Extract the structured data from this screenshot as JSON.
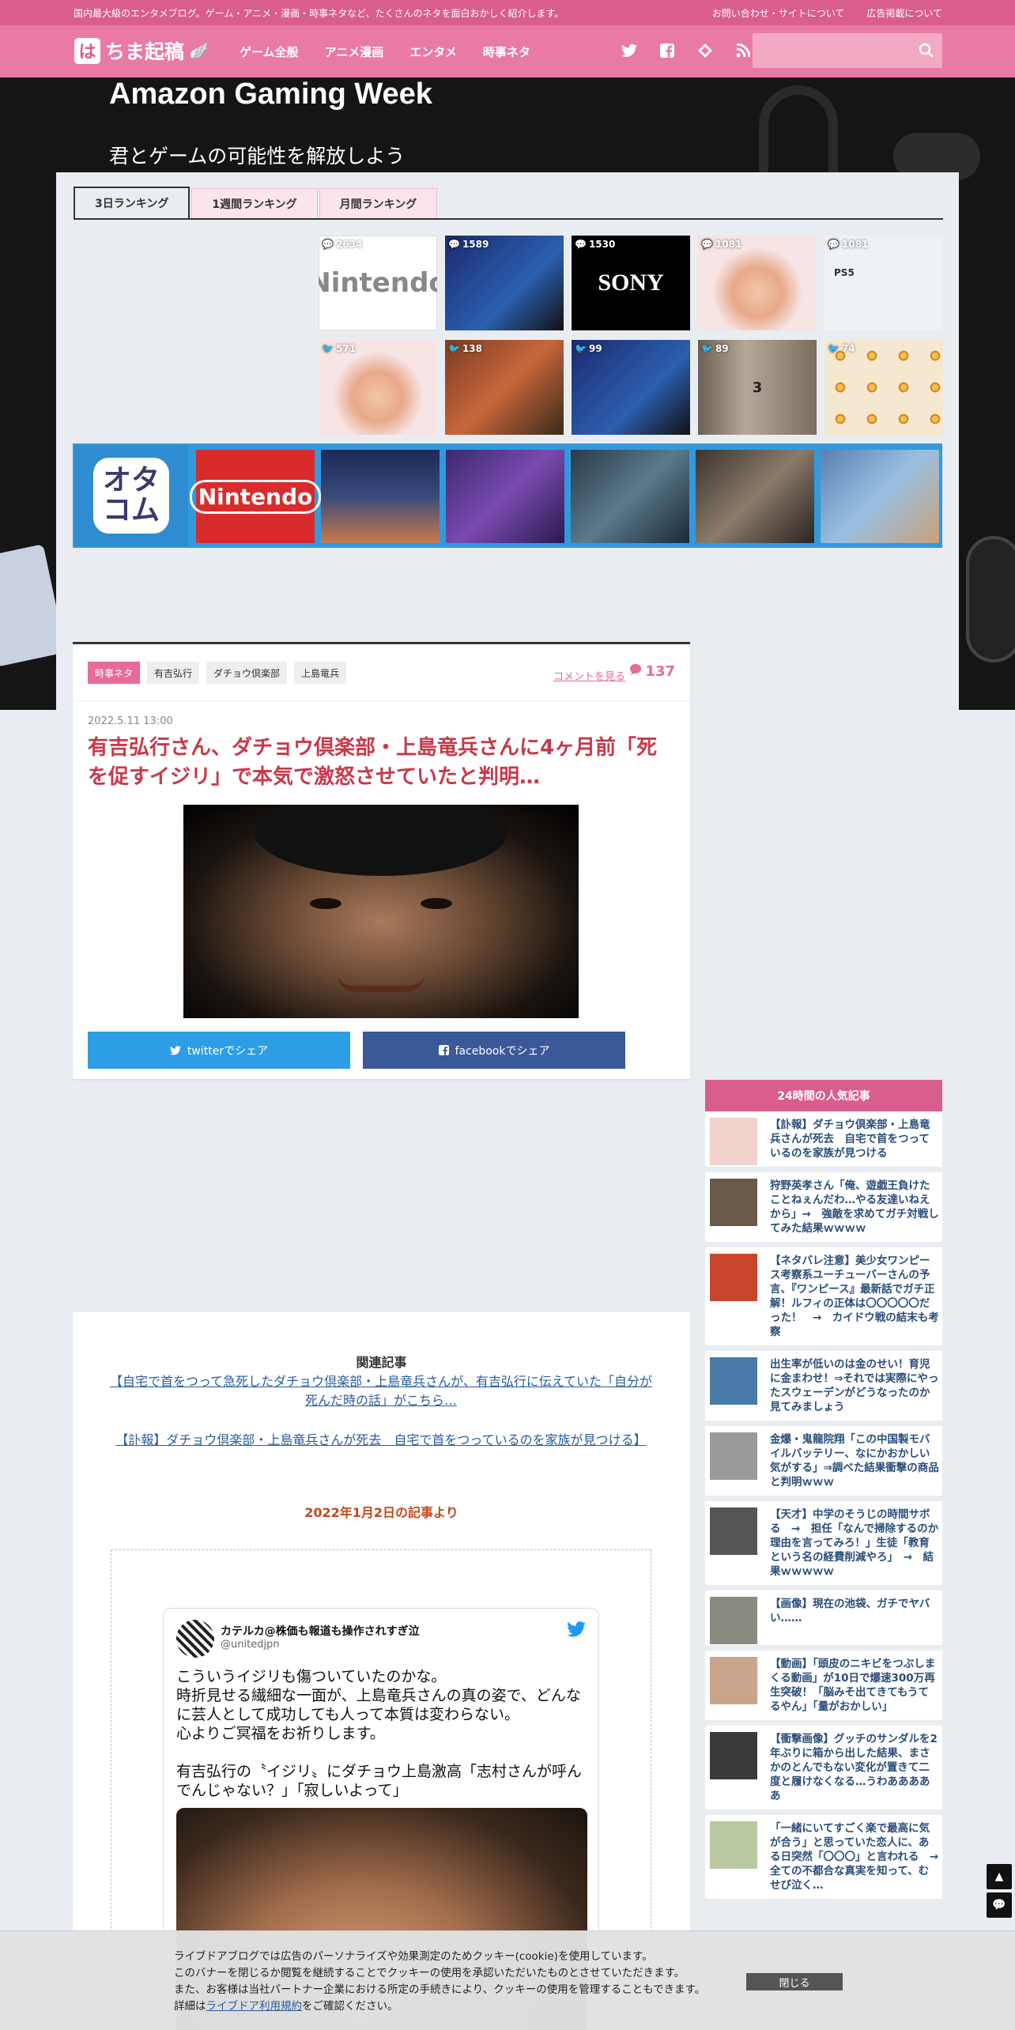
{
  "topbar": {
    "tagline": "国内最大級のエンタメブログ。ゲーム・アニメ・漫画・時事ネタなど、たくさんのネタを面白おかしく紹介します。",
    "contact": "お問い合わせ・サイトについて",
    "ads": "広告掲載について"
  },
  "header": {
    "logo_mark": "は",
    "logo_text": "ちま起稿",
    "nav": [
      "ゲーム全般",
      "アニメ漫画",
      "エンタメ",
      "時事ネタ"
    ],
    "social_icons": [
      "twitter-icon",
      "facebook-icon",
      "feedly-icon",
      "rss-icon"
    ],
    "search_placeholder": ""
  },
  "banner": {
    "title": "Amazon Gaming Week",
    "subtitle": "君とゲームの可能性を解放しよう"
  },
  "ranking": {
    "tabs": [
      "3日ランキング",
      "1週間ランキング",
      "月間ランキング"
    ],
    "items": [
      {
        "count": "2634",
        "type": "comment",
        "label": "Nintendo",
        "bg": "#ffffff",
        "fg": "#999999"
      },
      {
        "count": "1589",
        "type": "comment",
        "label": "",
        "bg": "#1c2a6e",
        "fg": "#ffffff"
      },
      {
        "count": "1530",
        "type": "comment",
        "label": "SONY",
        "bg": "#000000",
        "fg": "#ffffff"
      },
      {
        "count": "1081",
        "type": "comment",
        "label": "",
        "bg": "#f6dede",
        "fg": "#333333"
      },
      {
        "count": "1081",
        "type": "comment",
        "label": "PS5",
        "bg": "#e8ecf2",
        "fg": "#333333"
      },
      {
        "count": "571",
        "type": "twitter",
        "label": "",
        "bg": "#f6dede",
        "fg": "#333333"
      },
      {
        "count": "138",
        "type": "twitter",
        "label": "",
        "bg": "#7a3b22",
        "fg": "#ffffff"
      },
      {
        "count": "99",
        "type": "twitter",
        "label": "",
        "bg": "#1c2a6e",
        "fg": "#ffffff"
      },
      {
        "count": "89",
        "type": "twitter",
        "label": "3",
        "bg": "#9b8f80",
        "fg": "#333333"
      },
      {
        "count": "74",
        "type": "twitter",
        "label": "",
        "bg": "#c98a3a",
        "fg": "#ffffff"
      }
    ]
  },
  "promo": {
    "logo_text": "オタコム",
    "first_tile": "Nintendo",
    "tile_colors": [
      "#d92b2b",
      "#1b2a55",
      "#3a2a6e",
      "#2a3a4a",
      "#3b3530",
      "#5a7fb0"
    ]
  },
  "article": {
    "tags": [
      "時事ネタ",
      "有吉弘行",
      "ダチョウ倶楽部",
      "上島竜兵"
    ],
    "comment_link": "コメントを見る",
    "comment_count": "137",
    "date": "2022.5.11 13:00",
    "headline": "有吉弘行さん、ダチョウ倶楽部・上島竜兵さんに4ヶ月前「死を促すイジリ」で本気で激怒させていたと判明…",
    "share_twitter": "twitterでシェア",
    "share_facebook": "facebookでシェア"
  },
  "body": {
    "related_heading": "関連記事",
    "related1": "【自宅で首をつって急死したダチョウ倶楽部・上島竜兵さんが、有吉弘行に伝えていた「自分が死んだ時の話」がこちら…",
    "related2": "【訃報】ダチョウ倶楽部・上島竜兵さんが死去　自宅で首をつっているのを家族が見つける】",
    "date_note": "2022年1月2日の記事より",
    "tweet_name": "カテルカ@株価も報道も操作されすぎ泣",
    "tweet_handle": "@unitedjpn",
    "tweet_text": "こういうイジリも傷ついていたのかな。\n時折見せる繊細な一面が、上島竜兵さんの真の姿で、どんなに芸人として成功しても人って本質は変わらない。\n心よりご冥福をお祈りします。\n\n有吉弘行の〝イジリ〟にダチョウ上島激高「志村さんが呼んでんじゃない？」「寂しいよって」"
  },
  "popular": {
    "heading": "24時間の人気記事",
    "items": [
      {
        "text": "【訃報】ダチョウ倶楽部・上島竜兵さんが死去　自宅で首をつっているのを家族が見つける",
        "img": "#f1d2cc"
      },
      {
        "text": "狩野英孝さん「俺、遊戯王負けたことねぇんだわ…やる友達いねえから」→　強敵を求めてガチ対戦してみた結果ｗｗｗｗ",
        "img": "#6a5a4a"
      },
      {
        "text": "【ネタバレ注意】美少女ワンピース考察系ユーチューバーさんの予言、『ワンピース』最新話でガチ正解！ルフィの正体は〇〇〇〇〇だった！　→　カイドウ戦の結末も考察",
        "img": "#c8452e"
      },
      {
        "text": "出生率が低いのは金のせい！育児に金まわせ！⇒それでは実際にやったスウェーデンがどうなったのか見てみましょう",
        "img": "#4a7aa8"
      },
      {
        "text": "金爆・鬼龍院翔「この中国製モバイルバッテリー、なにかおかしい気がする」⇒調べた結果衝撃の商品と判明ｗｗｗ",
        "img": "#9a9a9a"
      },
      {
        "text": "【天才】中学のそうじの時間サボる　→　担任「なんで掃除するのか理由を言ってみろ！」生徒「教育という名の経費削減やろ」　→　結果ｗｗｗｗｗ",
        "img": "#555555"
      },
      {
        "text": "【画像】現在の池袋、ガチでヤバい……",
        "img": "#8a8a80"
      },
      {
        "text": "【動画】「頭皮のニキビをつぶしまくる動画」が10日で爆速300万再生突破！「脳みそ出てきてもうてるやん」「量がおかしい」",
        "img": "#c9a48a"
      },
      {
        "text": "【衝撃画像】グッチのサンダルを2年ぶりに箱から出した結果、まさかのとんでもない変化が置きて二度と履けなくなる…うわあああああ",
        "img": "#3a3a3a"
      },
      {
        "text": "「一緒にいてすごく楽で最高に気が合う」と思っていた恋人に、ある日突然「〇〇〇」と言われる　→　全ての不都合な真実を知って、むせび泣く…",
        "img": "#b9c8a0"
      }
    ]
  },
  "cookie": {
    "line1": "ライブドアブログでは広告のパーソナライズや効果測定のためクッキー(cookie)を使用しています。",
    "line2": "このバナーを閉じるか閲覧を継続することでクッキーの使用を承認いただいたものとさせていただきます。",
    "line3": "また、お客様は当社パートナー企業における所定の手続きにより、クッキーの使用を管理することもできます。",
    "line4_pre": "詳細は",
    "line4_link": "ライブドア利用規約",
    "line4_post": "をご確認ください。",
    "close": "閉じる"
  }
}
